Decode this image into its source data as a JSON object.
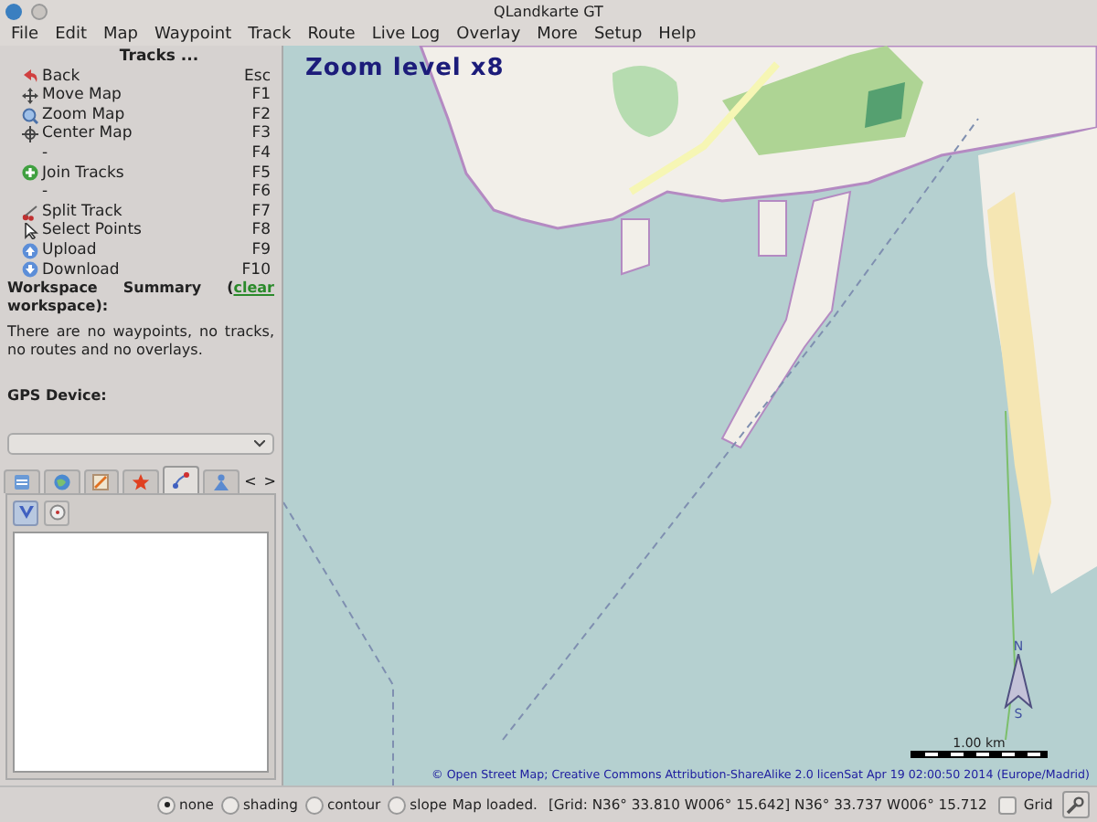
{
  "window": {
    "title": "QLandkarte GT"
  },
  "menu": [
    "File",
    "Edit",
    "Map",
    "Waypoint",
    "Track",
    "Route",
    "Live Log",
    "Overlay",
    "More",
    "Setup",
    "Help"
  ],
  "tracks_panel": {
    "title": "Tracks ...",
    "items": [
      {
        "label": "Back",
        "shortcut": "Esc"
      },
      {
        "label": "Move Map",
        "shortcut": "F1"
      },
      {
        "label": "Zoom Map",
        "shortcut": "F2"
      },
      {
        "label": "Center Map",
        "shortcut": "F3"
      },
      {
        "label": "-",
        "shortcut": "F4"
      },
      {
        "label": "Join Tracks",
        "shortcut": "F5"
      },
      {
        "label": "-",
        "shortcut": "F6"
      },
      {
        "label": "Split Track",
        "shortcut": "F7"
      },
      {
        "label": "Select Points",
        "shortcut": "F8"
      },
      {
        "label": "Upload",
        "shortcut": "F9"
      },
      {
        "label": "Download",
        "shortcut": "F10"
      }
    ]
  },
  "workspace": {
    "heading_start": "Workspace Summary (",
    "link": "clear",
    "heading_end": "workspace):",
    "summary": "There are no waypoints, no tracks, no routes and no overlays."
  },
  "gps": {
    "label": "GPS Device:"
  },
  "tabs": [
    {
      "selected": false
    },
    {
      "selected": false
    },
    {
      "selected": false
    },
    {
      "selected": false
    },
    {
      "selected": true
    },
    {
      "selected": false
    }
  ],
  "tab_scroll": [
    "<",
    ">"
  ],
  "list_toolbar": [
    {
      "selected": true
    },
    {
      "selected": false
    }
  ],
  "map": {
    "zoom_label": "Zoom level x8",
    "attribution": "© Open Street Map; Creative Commons Attribution-ShareAlike 2.0 licenSat Apr 19 02:00:50 2014 (Europe/Madrid)",
    "scale": "1.00 km",
    "compass": [
      "N",
      "S"
    ]
  },
  "status_bar": {
    "radios": [
      {
        "label": "none",
        "selected": true
      },
      {
        "label": "shading",
        "selected": false
      },
      {
        "label": "contour",
        "selected": false
      },
      {
        "label": "slope",
        "selected": false
      }
    ],
    "message": "Map loaded.",
    "coordinates": "[Grid: N36° 33.810 W006° 15.642] N36° 33.737 W006° 15.712",
    "grid": {
      "label": "Grid",
      "checked": false
    }
  }
}
